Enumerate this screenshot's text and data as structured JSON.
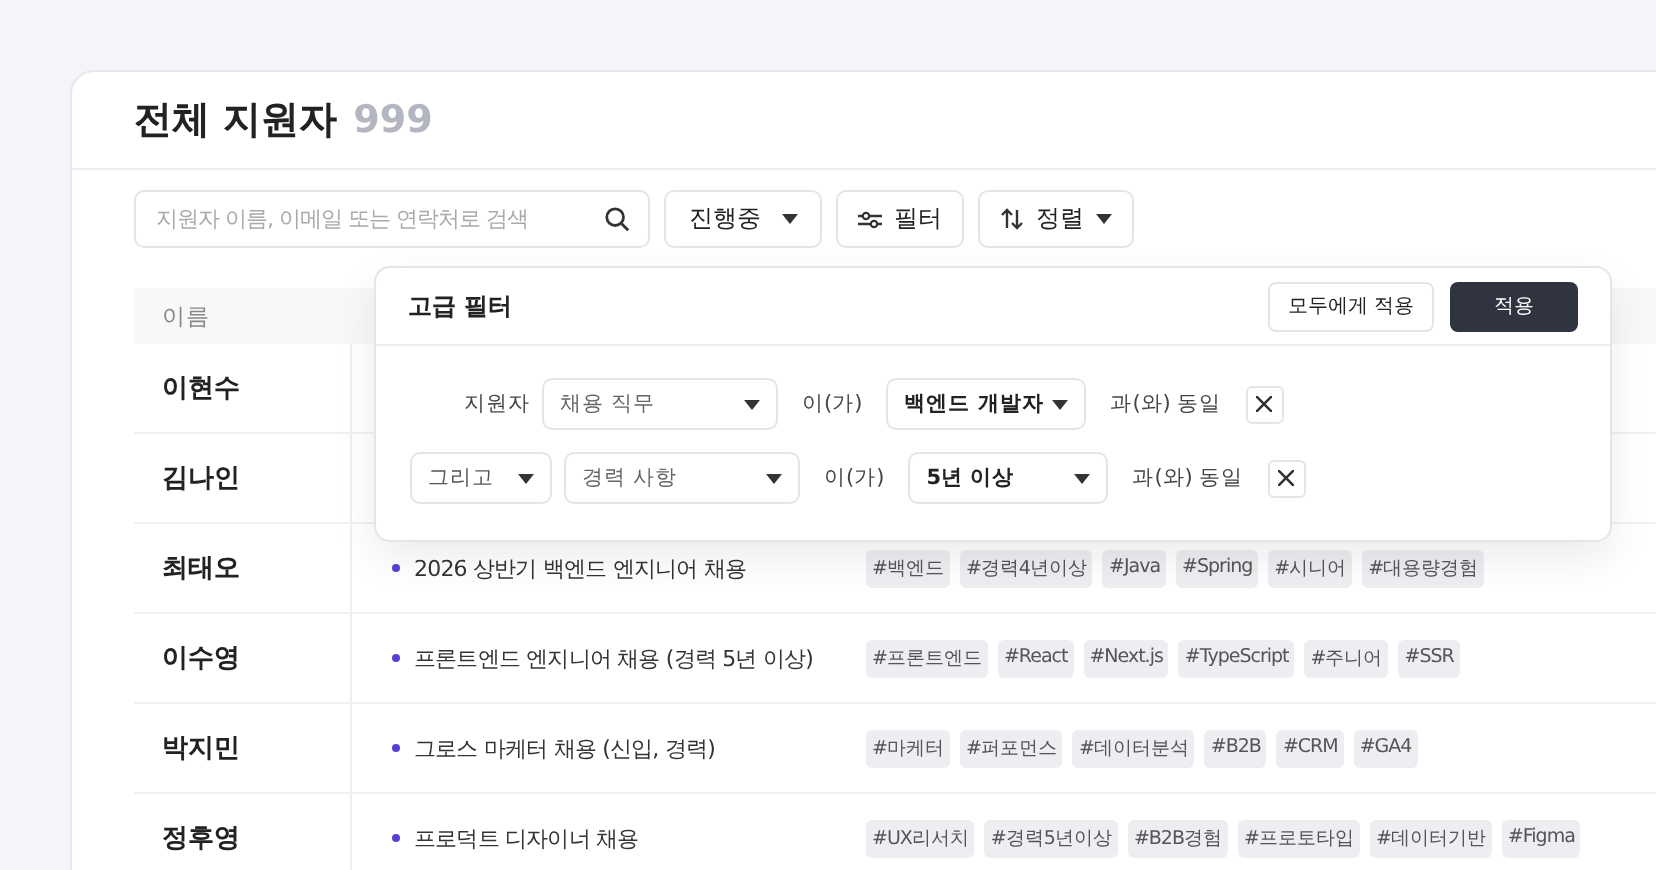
{
  "header": {
    "title": "전체 지원자",
    "count": "999"
  },
  "toolbar": {
    "search": {
      "placeholder": "지원자 이름, 이메일 또는 연락처로 검색"
    },
    "status_dropdown": "진행중",
    "filter_button": "필터",
    "sort_button": "정렬"
  },
  "table": {
    "columns": [
      "이름"
    ],
    "rows": [
      {
        "name": "이현수"
      },
      {
        "name": "김나인"
      },
      {
        "name": "최태오",
        "job": "2026 상반기 백엔드 엔지니어 채용",
        "tags": [
          "#백엔드",
          "#경력4년이상",
          "#Java",
          "#Spring",
          "#시니어",
          "#대용량경험"
        ]
      },
      {
        "name": "이수영",
        "job": "프론트엔드 엔지니어 채용 (경력 5년 이상)",
        "tags": [
          "#프론트엔드",
          "#React",
          "#Next.js",
          "#TypeScript",
          "#주니어",
          "#SSR"
        ]
      },
      {
        "name": "박지민",
        "job": "그로스 마케터 채용 (신입, 경력)",
        "tags": [
          "#마케터",
          "#퍼포먼스",
          "#데이터분석",
          "#B2B",
          "#CRM",
          "#GA4"
        ]
      },
      {
        "name": "정후영",
        "job": "프로덕트 디자이너 채용",
        "tags": [
          "#UX리서치",
          "#경력5년이상",
          "#B2B경험",
          "#프로토타입",
          "#데이터기반",
          "#Figma"
        ]
      }
    ]
  },
  "advanced_filter": {
    "title": "고급 필터",
    "apply_all_button": "모두에게 적용",
    "apply_button": "적용",
    "conditions": [
      {
        "kind": "label",
        "lead": "지원자",
        "field": "채용 직무",
        "subject_particle": "이(가)",
        "value": "백엔드 개발자",
        "operator": "과(와) 동일"
      },
      {
        "kind": "conjunction",
        "lead": "그리고",
        "field": "경력 사항",
        "subject_particle": "이(가)",
        "value": "5년 이상",
        "operator": "과(와) 동일"
      }
    ]
  }
}
